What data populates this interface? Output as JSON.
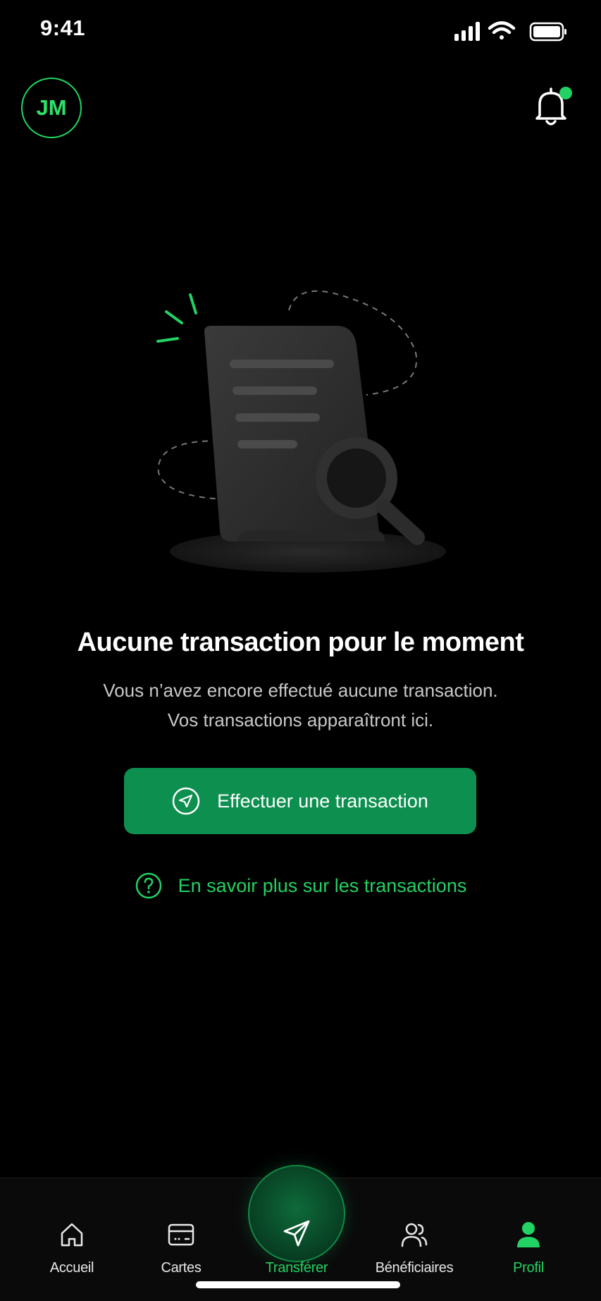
{
  "status_bar": {
    "time": "9:41"
  },
  "header": {
    "avatar_initials": "JM",
    "notification_badge": true
  },
  "empty_state": {
    "title": "Aucune transaction pour le moment",
    "description_line1": "Vous n’avez encore effectué aucune transaction.",
    "description_line2": "Vos transactions apparaîtront ici."
  },
  "actions": {
    "primary_label": "Effectuer une transaction",
    "learn_more_label": "En savoir plus sur les transactions"
  },
  "tabs": [
    {
      "label": "Accueil",
      "icon": "home-icon",
      "active": false
    },
    {
      "label": "Cartes",
      "icon": "card-icon",
      "active": false
    },
    {
      "label": "Transférer",
      "icon": "send-icon",
      "active": true
    },
    {
      "label": "Bénéficiaires",
      "icon": "users-icon",
      "active": false
    },
    {
      "label": "Profil",
      "icon": "user-icon",
      "active": false
    }
  ],
  "colors": {
    "accent": "#22d262",
    "button": "#0d8f4f",
    "background": "#000000"
  }
}
